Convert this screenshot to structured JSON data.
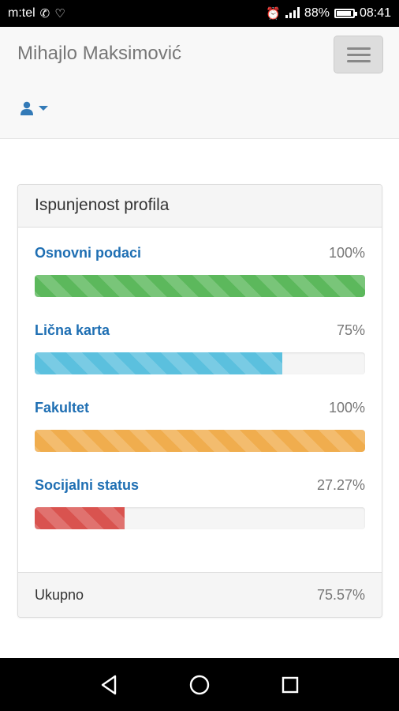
{
  "status_bar": {
    "carrier": "m:tel",
    "battery": "88%",
    "battery_level": 0.88,
    "time": "08:41"
  },
  "navbar": {
    "brand": "Mihajlo Maksimović",
    "user_icon": "user-icon"
  },
  "panel": {
    "title": "Ispunjenost profila",
    "items": [
      {
        "label": "Osnovni podaci",
        "percent_text": "100%",
        "percent": 100,
        "color": "#5cb85c"
      },
      {
        "label": "Lična karta",
        "percent_text": "75%",
        "percent": 75,
        "color": "#5bc0de"
      },
      {
        "label": "Fakultet",
        "percent_text": "100%",
        "percent": 100,
        "color": "#f0ad4e"
      },
      {
        "label": "Socijalni status",
        "percent_text": "27.27%",
        "percent": 27.27,
        "color": "#d9534f"
      }
    ],
    "footer": {
      "label": "Ukupno",
      "value": "75.57%"
    }
  },
  "colors": {
    "link": "#1f6fb3",
    "navbar_bg": "#f8f8f8"
  }
}
